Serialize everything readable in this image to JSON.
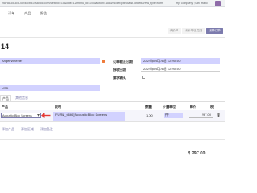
{
  "browser": {
    "url": "9878835-3c5-0-b4ccbd14saboc.com/web#id=18&cids=1&menu_id=140&action=188&model=purchase.order&view_type=form"
  },
  "navbar": {
    "menu": [
      {
        "label": "订单"
      },
      {
        "label": "产品"
      },
      {
        "label": "报告"
      }
    ],
    "company": "My Company (San Franc"
  },
  "control_panel": {
    "stages": [
      {
        "label": "询价单",
        "active": false
      },
      {
        "label": "询价单已发送",
        "active": false
      },
      {
        "label": "采购订单",
        "active": true
      }
    ]
  },
  "form": {
    "title": "14",
    "vendor": "Angel Wheeler",
    "vendor_ref": "",
    "currency": "USD",
    "date_order": {
      "label": "订单截止日期",
      "value": "2022年09月26日 12:00:00"
    },
    "date_planned": {
      "label": "接收日期",
      "value": "2022年09月26日 12:00:00"
    },
    "confirm": {
      "label": "要求确认",
      "checked": false
    },
    "tabs": [
      {
        "label": "产品"
      },
      {
        "label": "其他信息"
      }
    ],
    "lines": {
      "headers": [
        "产品",
        "说明",
        "数量",
        "计量单位",
        "单价",
        "税"
      ],
      "rows": [
        {
          "product": "Acoustic Bloc Screens",
          "description": "[FURN_6666] Acoustic Bloc Screens",
          "qty": "1.00",
          "uom": "件",
          "price": "297.00"
        }
      ]
    },
    "add_links": [
      "添加产品",
      "添加区域",
      "添加备注"
    ],
    "total": "$ 297.00"
  },
  "colors": {
    "accent": "#7c7bad",
    "required_field": "#d2d2ff",
    "annotation": "#e53935",
    "avatar": "#8e6ba8"
  },
  "icons": [
    "avatar",
    "external-link-icon",
    "chevron-down-icon",
    "annotation-arrow-icon",
    "trash-icon",
    "checkbox"
  ]
}
